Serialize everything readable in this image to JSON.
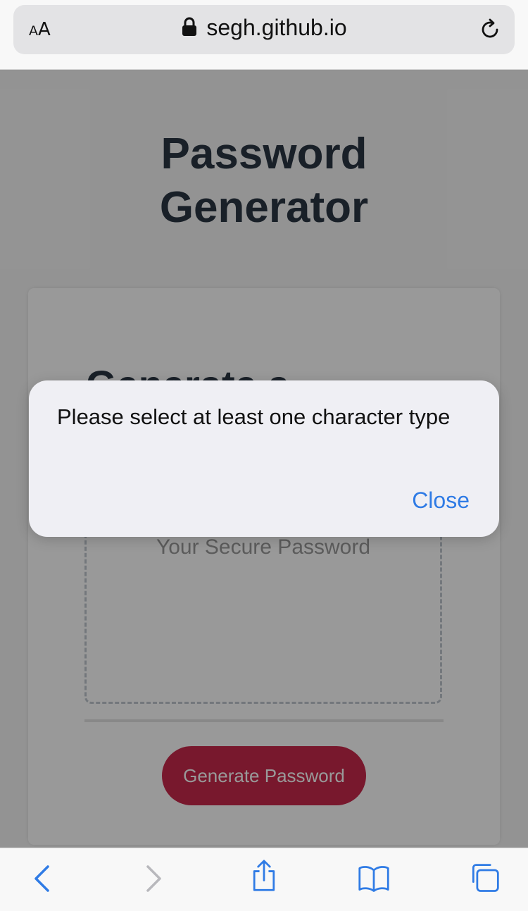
{
  "browser": {
    "aa_small": "A",
    "aa_big": "A",
    "url": "segh.github.io",
    "icons": [
      "text-size-icon",
      "lock-icon",
      "reload-icon"
    ]
  },
  "page": {
    "title": "Password\nGenerator",
    "card_header": "Generate a",
    "password_placeholder": "Your Secure Password",
    "generate_button": "Generate Password"
  },
  "alert": {
    "message": "Please select at least one character type",
    "close_label": "Close"
  },
  "toolbar": {
    "icons": [
      "back-icon",
      "forward-icon",
      "share-icon",
      "bookmarks-icon",
      "tabs-icon"
    ]
  },
  "colors": {
    "accent_blue": "#2f7be5",
    "button_red": "#c8284b",
    "title_dark": "#2b3643"
  }
}
